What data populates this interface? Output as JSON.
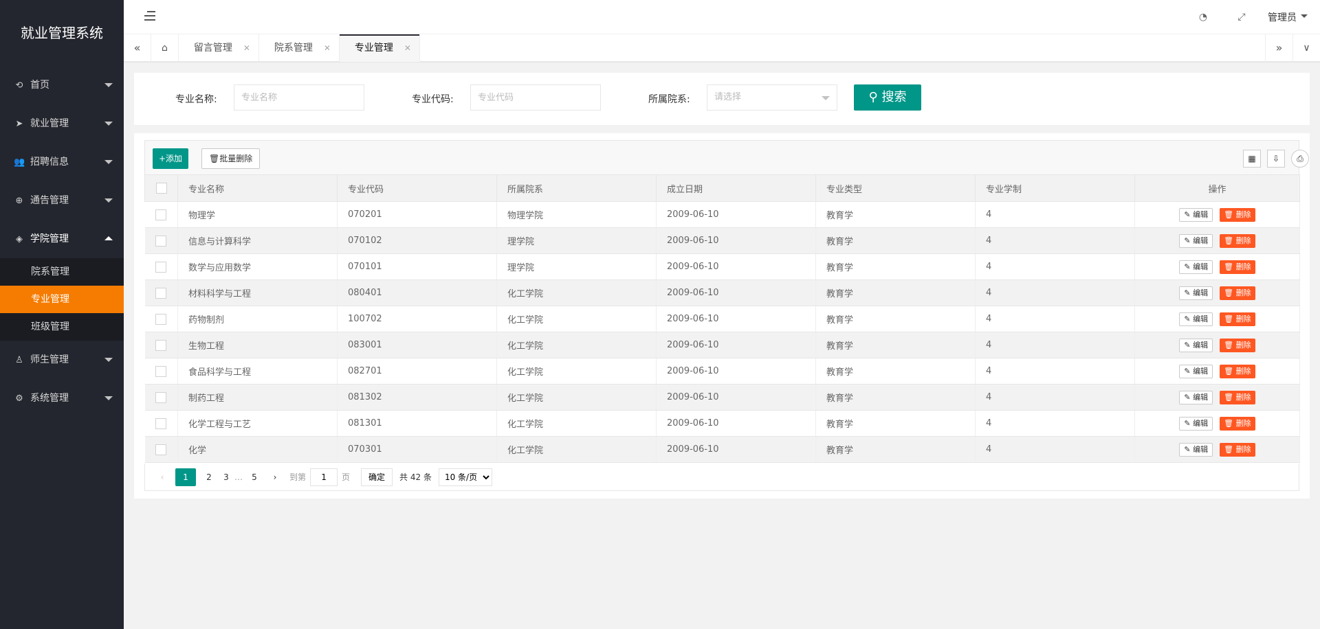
{
  "app": {
    "title": "就业管理系统"
  },
  "sidebar": {
    "items": [
      {
        "label": "首页",
        "icon": "home-icon"
      },
      {
        "label": "就业管理",
        "icon": "send-icon"
      },
      {
        "label": "招聘信息",
        "icon": "users-icon"
      },
      {
        "label": "通告管理",
        "icon": "globe-icon"
      },
      {
        "label": "学院管理",
        "icon": "layers-icon"
      },
      {
        "label": "师生管理",
        "icon": "user-icon"
      },
      {
        "label": "系统管理",
        "icon": "gear-icon"
      }
    ],
    "sub_items": [
      "院系管理",
      "专业管理",
      "班级管理"
    ],
    "active_sub": "专业管理",
    "accent_color": "#f57c00"
  },
  "header": {
    "user": "管理员",
    "icons": [
      "theme-icon",
      "fullscreen-icon"
    ]
  },
  "tabs": [
    {
      "label": "留言管理"
    },
    {
      "label": "院系管理"
    },
    {
      "label": "专业管理",
      "active": true
    }
  ],
  "search": {
    "name_label": "专业名称:",
    "name_placeholder": "专业名称",
    "code_label": "专业代码:",
    "code_placeholder": "专业代码",
    "dept_label": "所属院系:",
    "dept_placeholder": "请选择",
    "button": "搜索",
    "button_color": "#009688"
  },
  "toolbar": {
    "add": "+添加",
    "batch_delete": "批量删除"
  },
  "table": {
    "headers": [
      "专业名称",
      "专业代码",
      "所属院系",
      "成立日期",
      "专业类型",
      "专业学制",
      "操作"
    ],
    "rows": [
      [
        "物理学",
        "070201",
        "物理学院",
        "2009-06-10",
        "教育学",
        "4"
      ],
      [
        "信息与计算科学",
        "070102",
        "理学院",
        "2009-06-10",
        "教育学",
        "4"
      ],
      [
        "数学与应用数学",
        "070101",
        "理学院",
        "2009-06-10",
        "教育学",
        "4"
      ],
      [
        "材料科学与工程",
        "080401",
        "化工学院",
        "2009-06-10",
        "教育学",
        "4"
      ],
      [
        "药物制剂",
        "100702",
        "化工学院",
        "2009-06-10",
        "教育学",
        "4"
      ],
      [
        "生物工程",
        "083001",
        "化工学院",
        "2009-06-10",
        "教育学",
        "4"
      ],
      [
        "食品科学与工程",
        "082701",
        "化工学院",
        "2009-06-10",
        "教育学",
        "4"
      ],
      [
        "制药工程",
        "081302",
        "化工学院",
        "2009-06-10",
        "教育学",
        "4"
      ],
      [
        "化学工程与工艺",
        "081301",
        "化工学院",
        "2009-06-10",
        "教育学",
        "4"
      ],
      [
        "化学",
        "070301",
        "化工学院",
        "2009-06-10",
        "教育学",
        "4"
      ]
    ],
    "edit_label": "编辑",
    "delete_label": "删除",
    "delete_color": "#ff5722"
  },
  "pagination": {
    "pages": [
      "1",
      "2",
      "3",
      "5"
    ],
    "current": "1",
    "ellipsis": "…",
    "goto_label": "到第",
    "goto_value": "1",
    "page_unit": "页",
    "confirm": "确定",
    "total": "共 42 条",
    "page_size": "10 条/页"
  }
}
